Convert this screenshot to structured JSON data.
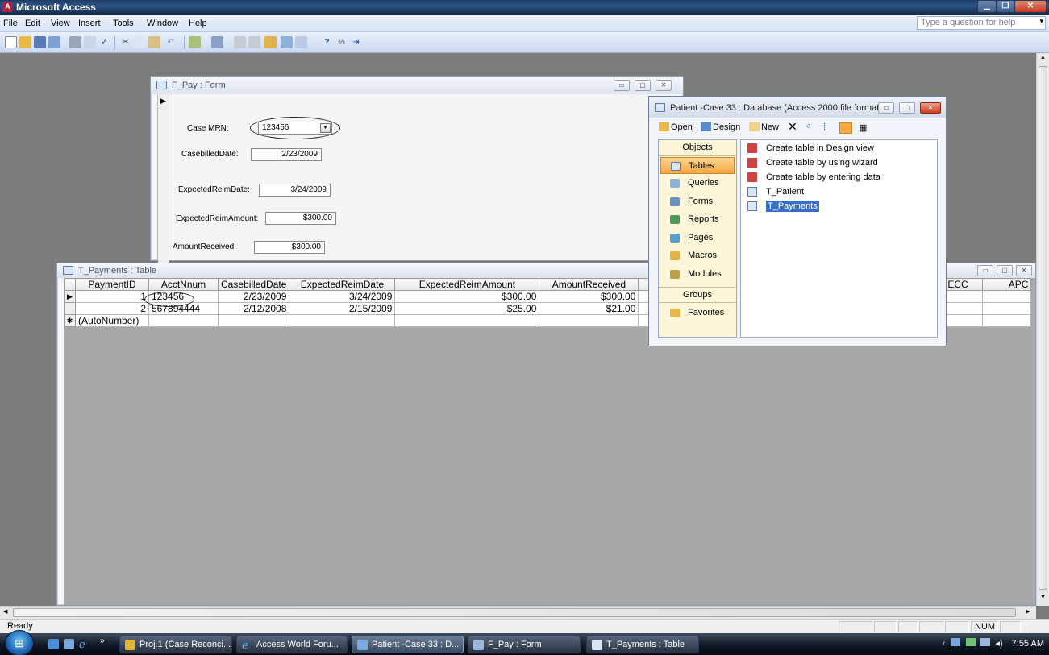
{
  "app": {
    "title": "Microsoft Access"
  },
  "menubar": {
    "items": [
      "File",
      "Edit",
      "View",
      "Insert",
      "Tools",
      "Window",
      "Help"
    ],
    "help_placeholder": "Type a question for help"
  },
  "form_window": {
    "title": "F_Pay : Form",
    "fields": {
      "case_mrn": {
        "label": "Case MRN:",
        "value": "123456"
      },
      "case_billed_date": {
        "label": "CasebilledDate:",
        "value": "2/23/2009"
      },
      "expected_reim_date": {
        "label": "ExpectedReimDate:",
        "value": "3/24/2009"
      },
      "expected_reim_amount": {
        "label": "ExpectedReimAmount:",
        "value": "$300.00"
      },
      "amount_received": {
        "label": "AmountReceived:",
        "value": "$300.00"
      }
    }
  },
  "table_window": {
    "title": "T_Payments : Table",
    "columns": [
      "PaymentID",
      "AcctNnum",
      "CasebilledDate",
      "ExpectedReimDate",
      "ExpectedReimAmount",
      "AmountReceived",
      "",
      "ECC",
      "APC"
    ],
    "rows": [
      {
        "selector": "▶",
        "cells": [
          "1",
          "123456",
          "2/23/2009",
          "3/24/2009",
          "$300.00",
          "$300.00",
          "",
          "",
          ""
        ]
      },
      {
        "selector": "",
        "cells": [
          "2",
          "567894444",
          "2/12/2008",
          "2/15/2009",
          "$25.00",
          "$21.00",
          "",
          "",
          ""
        ]
      },
      {
        "selector": "✱",
        "cells": [
          "(AutoNumber)",
          "",
          "",
          "",
          "",
          "",
          "",
          "",
          ""
        ]
      }
    ]
  },
  "db_window": {
    "title": "Patient -Case 33 : Database (Access 2000 file format)",
    "toolbar": {
      "open": "Open",
      "design": "Design",
      "new": "New"
    },
    "objects_header": "Objects",
    "objects": [
      "Tables",
      "Queries",
      "Forms",
      "Reports",
      "Pages",
      "Macros",
      "Modules"
    ],
    "groups_header": "Groups",
    "groups": [
      "Favorites"
    ],
    "list_items": [
      "Create table in Design view",
      "Create table by using wizard",
      "Create table by entering data",
      "T_Patient",
      "T_Payments"
    ]
  },
  "statusbar": {
    "left": "Ready",
    "num": "NUM"
  },
  "taskbar": {
    "buttons": [
      "Proj.1 (Case Reconci...",
      "Access World Foru...",
      "Patient -Case 33 : D...",
      "F_Pay : Form",
      "T_Payments : Table"
    ],
    "clock": "7:55 AM"
  },
  "colors": {
    "accent": "#3a6ec6",
    "selected_object": "#f6a843"
  }
}
